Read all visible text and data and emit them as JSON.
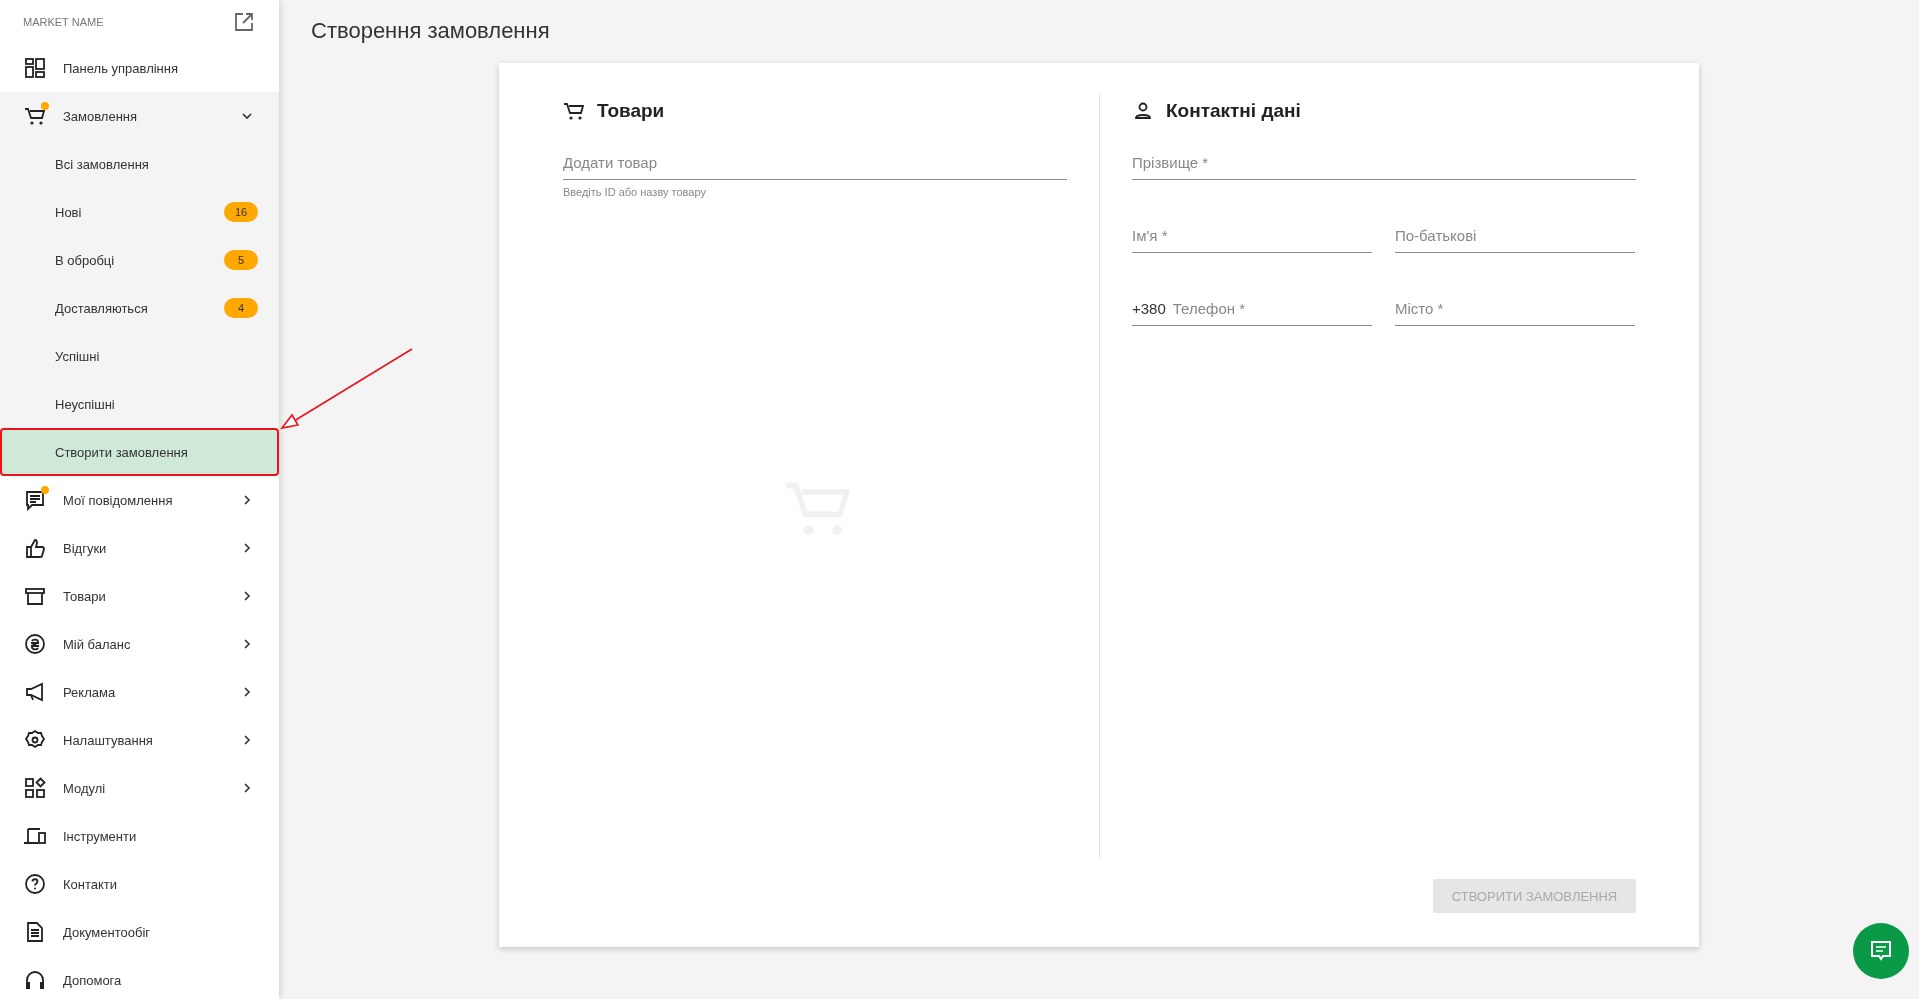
{
  "sidebar": {
    "market_name": "MARKET NAME",
    "items": [
      {
        "label": "Панель управління",
        "unread": false
      },
      {
        "label": "Замовлення",
        "unread": true,
        "expanded": true,
        "children": [
          {
            "label": "Всі замовлення",
            "selected": false,
            "annotated": false
          },
          {
            "label": "Нові",
            "badge": "16",
            "selected": false,
            "annotated": false
          },
          {
            "label": "В обробці",
            "badge": "5",
            "selected": false,
            "annotated": false
          },
          {
            "label": "Доставляються",
            "badge": "4",
            "selected": false,
            "annotated": false
          },
          {
            "label": "Успішні",
            "selected": false,
            "annotated": false
          },
          {
            "label": "Неуспішні",
            "selected": false,
            "annotated": false
          },
          {
            "label": "Створити замовлення",
            "selected": true,
            "annotated": true
          }
        ]
      },
      {
        "label": "Мої повідомлення",
        "unread": true,
        "expanded": false
      },
      {
        "label": "Відгуки",
        "unread": false,
        "expanded": false
      },
      {
        "label": "Товари",
        "unread": false,
        "expanded": false
      },
      {
        "label": "Мій баланс",
        "unread": false,
        "expanded": false
      },
      {
        "label": "Реклама",
        "unread": false,
        "expanded": false
      },
      {
        "label": "Налаштування",
        "unread": false,
        "expanded": false
      },
      {
        "label": "Модулі",
        "unread": false,
        "expanded": false
      },
      {
        "label": "Інструменти",
        "unread": false
      },
      {
        "label": "Контакти",
        "unread": false
      },
      {
        "label": "Документообіг",
        "unread": false
      },
      {
        "label": "Допомога",
        "unread": false
      }
    ]
  },
  "page_title": "Створення замовлення",
  "products": {
    "title": "Товари",
    "field": {
      "placeholder": "Додати товар",
      "hint": "Введіть ID або назву товару"
    }
  },
  "contacts": {
    "title": "Контактні дані",
    "fields": [
      {
        "kind": "full",
        "placeholder": "Прізвище *"
      },
      {
        "kind": "half",
        "placeholder": "Ім'я *"
      },
      {
        "kind": "half",
        "placeholder": "По-батькові"
      },
      {
        "kind": "phone",
        "prefix": "+380",
        "placeholder": "Телефон *"
      },
      {
        "kind": "half",
        "placeholder": "Місто *"
      }
    ]
  },
  "submit_button": {
    "label": "СТВОРИТИ ЗАМОВЛЕННЯ",
    "disabled": true
  }
}
